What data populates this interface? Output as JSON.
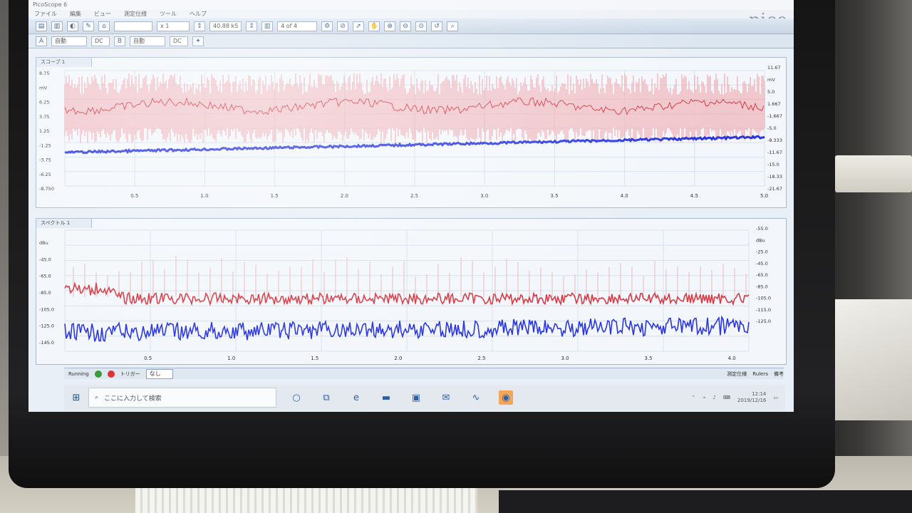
{
  "window": {
    "title": "PicoScope 6",
    "logo": "pico"
  },
  "menu": [
    "ファイル",
    "編集",
    "ビュー",
    "測定仕様",
    "ツール",
    "ヘルプ"
  ],
  "toolbar": {
    "timebase": "40.88 kS",
    "buffer": "4 of 4",
    "scale": "x 1"
  },
  "toolbar2": {
    "chA_range": "自動",
    "chA_coupling": "DC",
    "chB_range": "自動",
    "chB_coupling": "DC"
  },
  "scope_view": {
    "tab_label": "スコープ 1",
    "x_ticks": [
      "0.5",
      "1.0",
      "1.5",
      "2.0",
      "2.5",
      "3.0",
      "3.5",
      "4.0",
      "4.5",
      "5.0"
    ],
    "right_ticks": [
      "11.67",
      "mV",
      "5.0",
      "1.667",
      "-1.667",
      "-5.0",
      "-8.333",
      "-11.67",
      "-15.0",
      "-18.33",
      "-21.67"
    ],
    "left_ticks": [
      "8.75",
      "mV",
      "6.25",
      "3.75",
      "1.25",
      "-1.25",
      "-3.75",
      "-6.25",
      "-8.750"
    ],
    "series_colors": {
      "red": "#d63a44",
      "blue": "#2a36e0",
      "red_fill": "#eea8ae"
    }
  },
  "spectrum_view": {
    "tab_label": "スペクトル 1",
    "x_ticks": [
      "0.5",
      "1.0",
      "1.5",
      "2.0",
      "2.5",
      "3.0",
      "3.5",
      "4.0"
    ],
    "right_ticks": [
      "-55.0",
      "dBu",
      "-25.0",
      "-45.0",
      "-65.0",
      "-85.0",
      "-105.0",
      "-115.0",
      "-125.0"
    ],
    "left_ticks": [
      "dBu",
      "-45.0",
      "-65.0",
      "-85.0",
      "-105.0",
      "-125.0",
      "-145.0"
    ]
  },
  "status_bar": {
    "state": "Running",
    "trigger_label": "トリガー",
    "trigger_mode": "なし",
    "measure_label": "測定仕様",
    "rulers_label": "Rulers",
    "notes_label": "備考"
  },
  "taskbar": {
    "search_placeholder": "ここに入力して検索",
    "time": "12:14",
    "date": "2019/12/16"
  }
}
